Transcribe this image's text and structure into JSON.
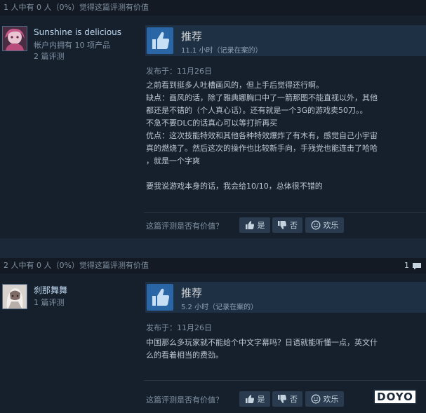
{
  "colors": {
    "background": "#1b2838",
    "accent": "#2a65a5",
    "username": "#c1dbf4"
  },
  "reviews": [
    {
      "helpful_summary": "1 人中有 0 人（0%）觉得这篇评测有价值",
      "username": "Sunshine is delicious",
      "owned_games": "帐户内拥有 10 项产品",
      "review_count": "2 篇评测",
      "verdict": "推荐",
      "hours": "11.1 小时（记录在案的）",
      "posted": "发布于：11月26日",
      "body": [
        "之前看到挺多人吐槽画风的，但上手后觉得还行啊。",
        "缺点：画风的话，除了雅典娜胸口中了一箭那图不能直视以外，其他",
        "都还是不错的（个人真心话）。还有就是一个3G的游戏卖50刀。。",
        "不急不要DLC的话真心可以等打折再买",
        "优点：这次技能特效和其他各种特效爆炸了有木有，感觉自己小宇宙",
        "真的燃烧了。然后这次的操作也比较新手向，手残党也能连击了哈哈",
        "，就是一个字爽",
        "",
        "要我说游戏本身的话，我会给10/10，总体很不错的"
      ],
      "helpful_question": "这篇评测是否有价值？",
      "buttons": {
        "yes": "是",
        "no": "否",
        "funny": "欢乐"
      }
    },
    {
      "helpful_summary": "2 人中有 0 人（0%）觉得这篇评测有价值",
      "comment_count": "1",
      "username": "刹那舞舞",
      "review_count": "1 篇评测",
      "verdict": "推荐",
      "hours": "5.2 小时（记录在案的）",
      "posted": "发布于：11月26日",
      "body": [
        "中国那么多玩家就不能给个中文字幕吗？日语就能听懂一点，英文什",
        "么的看着相当的费劲。"
      ],
      "helpful_question": "这篇评测是否有价值？",
      "buttons": {
        "yes": "是",
        "no": "否",
        "funny": "欢乐"
      }
    }
  ],
  "watermark": "DOYO"
}
